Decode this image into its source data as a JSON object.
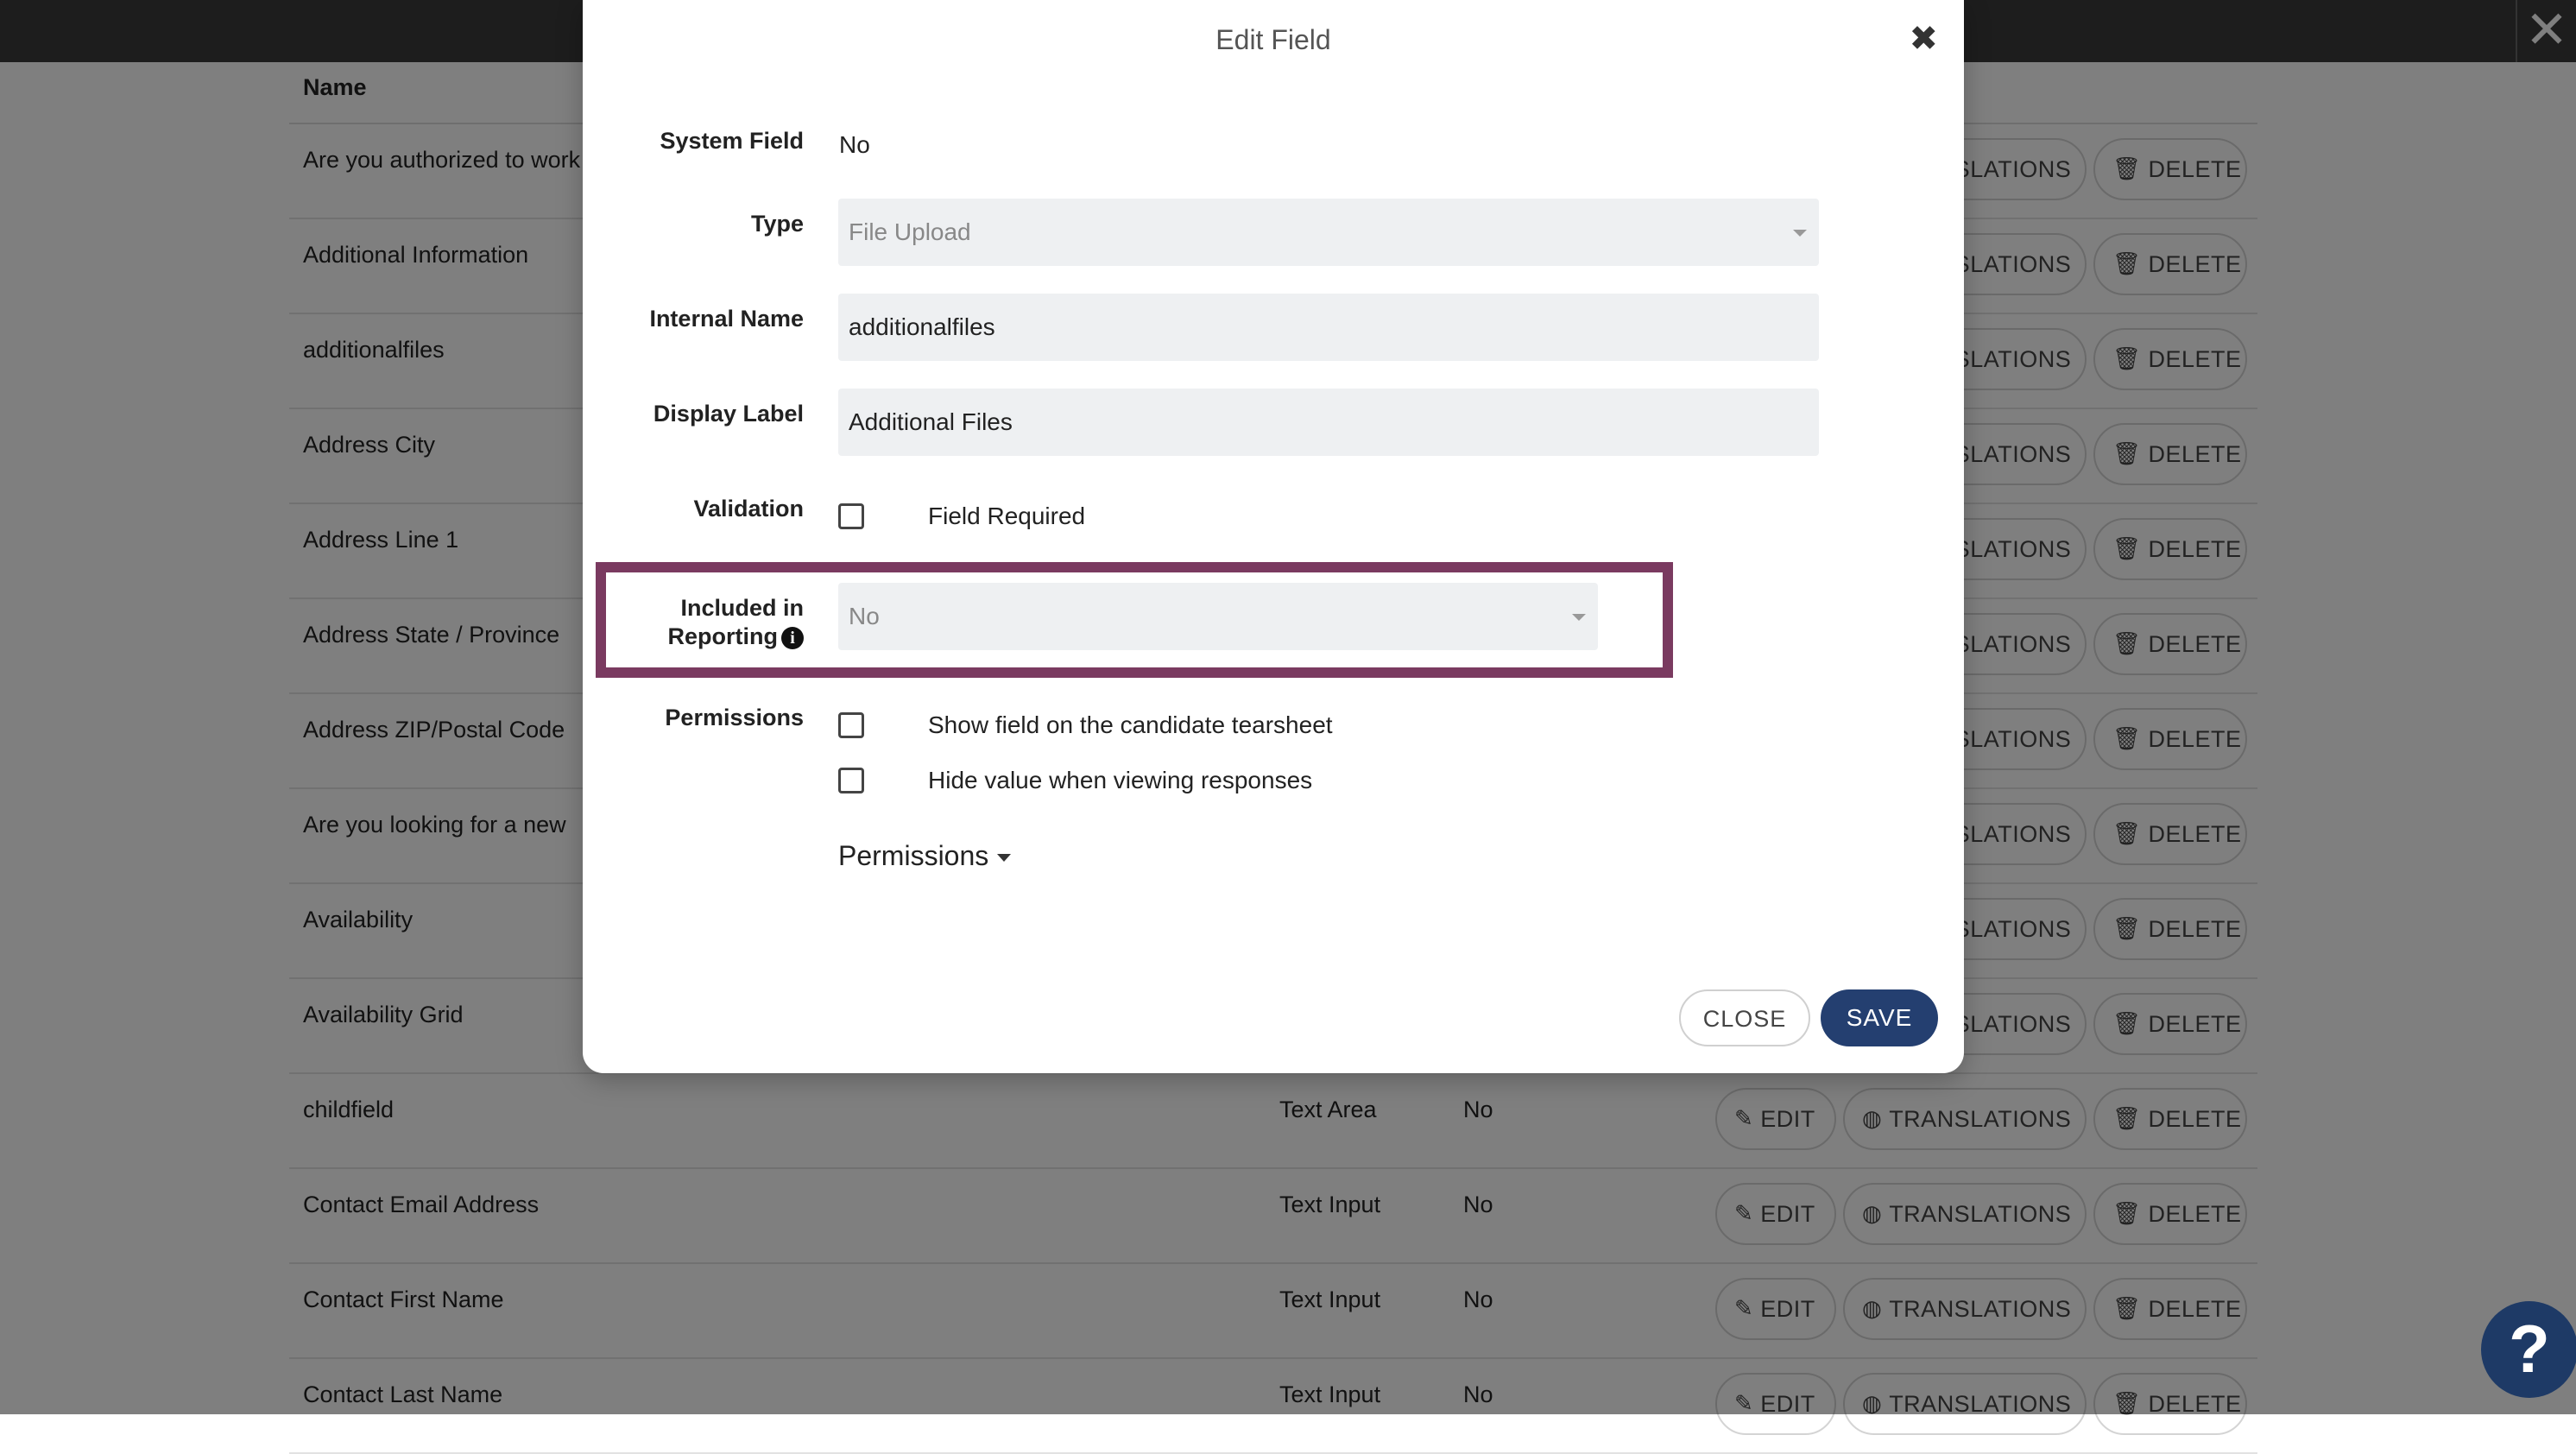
{
  "background": {
    "close_glyph": "✕",
    "column_header": "Name",
    "action_labels": {
      "edit": "EDIT",
      "translations": "TRANSLATIONS",
      "delete": "DELETE"
    },
    "rows": [
      {
        "name": "Are you authorized to work",
        "type": "",
        "system": ""
      },
      {
        "name": "Additional Information",
        "type": "",
        "system": ""
      },
      {
        "name": "additionalfiles",
        "type": "",
        "system": ""
      },
      {
        "name": "Address City",
        "type": "",
        "system": ""
      },
      {
        "name": "Address Line 1",
        "type": "",
        "system": ""
      },
      {
        "name": "Address State / Province",
        "type": "",
        "system": ""
      },
      {
        "name": "Address ZIP/Postal Code",
        "type": "",
        "system": ""
      },
      {
        "name": "Are you looking for a new",
        "type": "",
        "system": ""
      },
      {
        "name": "Availability",
        "type": "",
        "system": ""
      },
      {
        "name": "Availability Grid",
        "type": "",
        "system": ""
      },
      {
        "name": "childfield",
        "type": "Text Area",
        "system": "No"
      },
      {
        "name": "Contact Email Address",
        "type": "Text Input",
        "system": "No"
      },
      {
        "name": "Contact First Name",
        "type": "Text Input",
        "system": "No"
      },
      {
        "name": "Contact Last Name",
        "type": "Text Input",
        "system": "No"
      }
    ],
    "help_label": "?"
  },
  "modal": {
    "title": "Edit Field",
    "close_glyph": "✖",
    "system_field": {
      "label": "System Field",
      "value": "No"
    },
    "type": {
      "label": "Type",
      "value": "File Upload"
    },
    "internal_name": {
      "label": "Internal Name",
      "value": "additionalfiles"
    },
    "display_label": {
      "label": "Display Label",
      "value": "Additional Files"
    },
    "validation": {
      "label": "Validation",
      "option": "Field Required",
      "checked": false
    },
    "reporting": {
      "label_line1": "Included in",
      "label_line2": "Reporting",
      "info_glyph": "i",
      "value": "No"
    },
    "permissions": {
      "label": "Permissions",
      "options": [
        {
          "label": "Show field on the candidate tearsheet",
          "checked": false
        },
        {
          "label": "Hide value when viewing responses",
          "checked": false
        }
      ],
      "dropdown_label": "Permissions"
    },
    "buttons": {
      "close": "CLOSE",
      "save": "SAVE"
    },
    "highlight_color": "#7a3a60",
    "save_color": "#243f70"
  }
}
